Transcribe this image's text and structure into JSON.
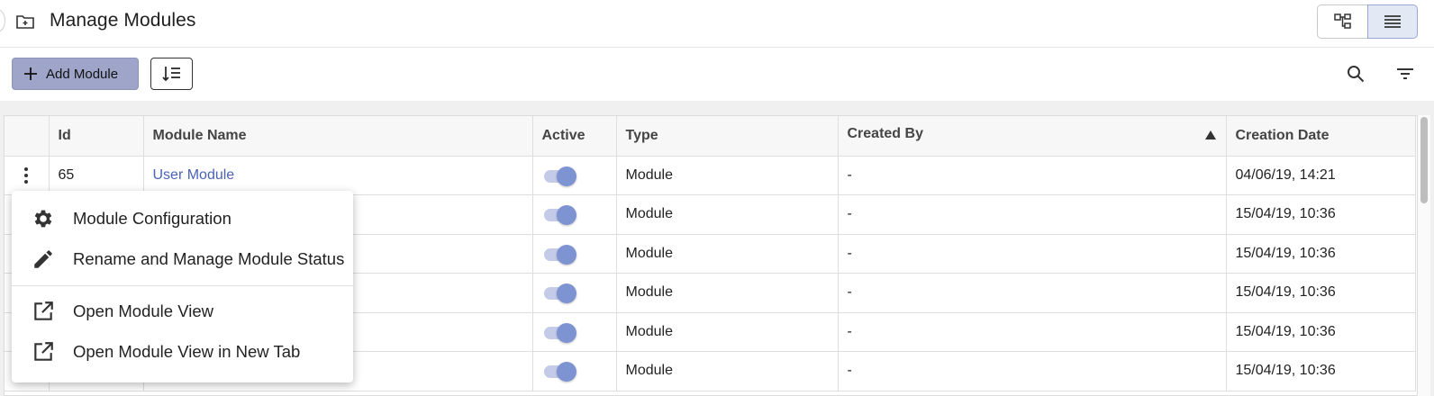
{
  "header": {
    "title": "Manage Modules",
    "icon": "folder-add-icon",
    "view_toggle": [
      "hierarchy-view-icon",
      "list-view-icon"
    ]
  },
  "toolbar": {
    "add_label": "Add Module",
    "sort_icon": "sort-order-icon",
    "search_icon": "search-icon",
    "filter_icon": "filter-icon"
  },
  "table": {
    "columns": [
      "",
      "Id",
      "Module Name",
      "Active",
      "Type",
      "Created By",
      "Creation Date"
    ],
    "sorted_column": "Created By",
    "sort_direction": "ascending",
    "rows": [
      {
        "id": "65",
        "name": "User Module",
        "active": true,
        "type": "Module",
        "created_by": "-",
        "date": "04/06/19, 14:21"
      },
      {
        "id": "",
        "name": "",
        "active": true,
        "type": "Module",
        "created_by": "-",
        "date": "15/04/19, 10:36"
      },
      {
        "id": "",
        "name": "",
        "active": true,
        "type": "Module",
        "created_by": "-",
        "date": "15/04/19, 10:36"
      },
      {
        "id": "",
        "name": "",
        "active": true,
        "type": "Module",
        "created_by": "-",
        "date": "15/04/19, 10:36"
      },
      {
        "id": "",
        "name": "",
        "active": true,
        "type": "Module",
        "created_by": "-",
        "date": "15/04/19, 10:36"
      },
      {
        "id": "",
        "name": "",
        "active": true,
        "type": "Module",
        "created_by": "-",
        "date": "15/04/19, 10:36"
      }
    ]
  },
  "context_menu": {
    "items": [
      {
        "label": "Module Configuration",
        "icon": "gear-icon"
      },
      {
        "label": "Rename and Manage Module Status",
        "icon": "pencil-icon"
      },
      {
        "label": "Open Module View",
        "icon": "open-external-icon"
      },
      {
        "label": "Open Module View in New Tab",
        "icon": "open-external-icon"
      }
    ]
  },
  "colors": {
    "accent": "#7e93d2",
    "add_button": "#9fa5c9",
    "link": "#4a63b5"
  }
}
